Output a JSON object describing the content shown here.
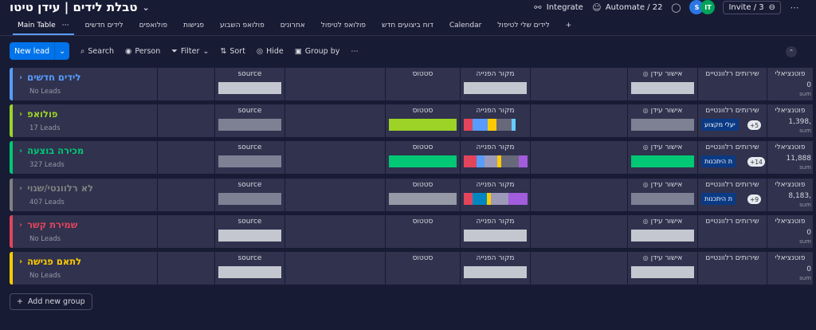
{
  "board": {
    "title": "טבלת לידים | עידן טיטו"
  },
  "top": {
    "integrate": "Integrate",
    "automate": "Automate / 22",
    "avatar_s": "S",
    "avatar_it": "IT",
    "invite": "Invite / 3"
  },
  "tabs": [
    "Main Table",
    "לידים חדשים",
    "פולואפים",
    "פגישות",
    "פולואפ השבוע",
    "אחרונים",
    "פולואפ לטיפול",
    "דוח ביצועים חדש",
    "Calendar",
    "לידים שלי לטיפול"
  ],
  "toolbar": {
    "new_lead": "New lead",
    "search": "Search",
    "person": "Person",
    "filter": "Filter",
    "sort": "Sort",
    "hide": "Hide",
    "group_by": "Group by"
  },
  "columns": {
    "source": "source",
    "status": "סטטוס",
    "origin": "מקור הפנייה",
    "approval": "אישור עידן",
    "services": "שירותים רלוונטיים",
    "potential": "פוטנציאלי",
    "sum": "sum"
  },
  "groups": [
    {
      "name": "לידים חדשים",
      "count": "No Leads",
      "color": "#579bfc",
      "potential": "0",
      "status_color": "",
      "origin": [],
      "approval_color": "",
      "service_tag": "",
      "service_more": ""
    },
    {
      "name": "פולואפ",
      "count": "17 Leads",
      "color": "#9cd326",
      "potential": "1,398,",
      "status_color": "#9cd326",
      "origin": [
        [
          "#e2445c",
          0.14
        ],
        [
          "#579bfc",
          0.24
        ],
        [
          "#ffcb00",
          0.14
        ],
        [
          "#676879",
          0.24
        ],
        [
          "#66ccff",
          0.06
        ]
      ],
      "approval_color": "",
      "service_tag": "יעלי מקצוע",
      "service_more": "+5"
    },
    {
      "name": "מכירה בוצעה",
      "count": "327 Leads",
      "color": "#00c875",
      "potential": "11,888",
      "status_color": "#00c875",
      "origin": [
        [
          "#e2445c",
          0.2
        ],
        [
          "#579bfc",
          0.12
        ],
        [
          "#9d99b9",
          0.2
        ],
        [
          "#ffcb00",
          0.06
        ],
        [
          "#676879",
          0.28
        ],
        [
          "#a25ddc",
          0.14
        ]
      ],
      "approval_color": "#00c875",
      "service_tag": "ת היתכנות",
      "service_more": "+14"
    },
    {
      "name": "לא רלוונטי/שגוי",
      "count": "407 Leads",
      "color": "#808080",
      "potential": "8,183,",
      "status_color": "#9699a6",
      "origin": [
        [
          "#e2445c",
          0.14
        ],
        [
          "#0086c0",
          0.22
        ],
        [
          "#ffcb00",
          0.06
        ],
        [
          "#9d99b9",
          0.28
        ],
        [
          "#a25ddc",
          0.3
        ]
      ],
      "approval_color": "",
      "service_tag": "ת היתכנות",
      "service_more": "+9"
    },
    {
      "name": "שמירת קשר",
      "count": "No Leads",
      "color": "#e2445c",
      "potential": "0",
      "status_color": "",
      "origin": [],
      "approval_color": "",
      "service_tag": "",
      "service_more": ""
    },
    {
      "name": "לתאם פגישה",
      "count": "No Leads",
      "color": "#ffcb00",
      "potential": "0",
      "status_color": "",
      "origin": [],
      "approval_color": "",
      "service_tag": "",
      "service_more": ""
    }
  ],
  "add_group": "Add new group"
}
